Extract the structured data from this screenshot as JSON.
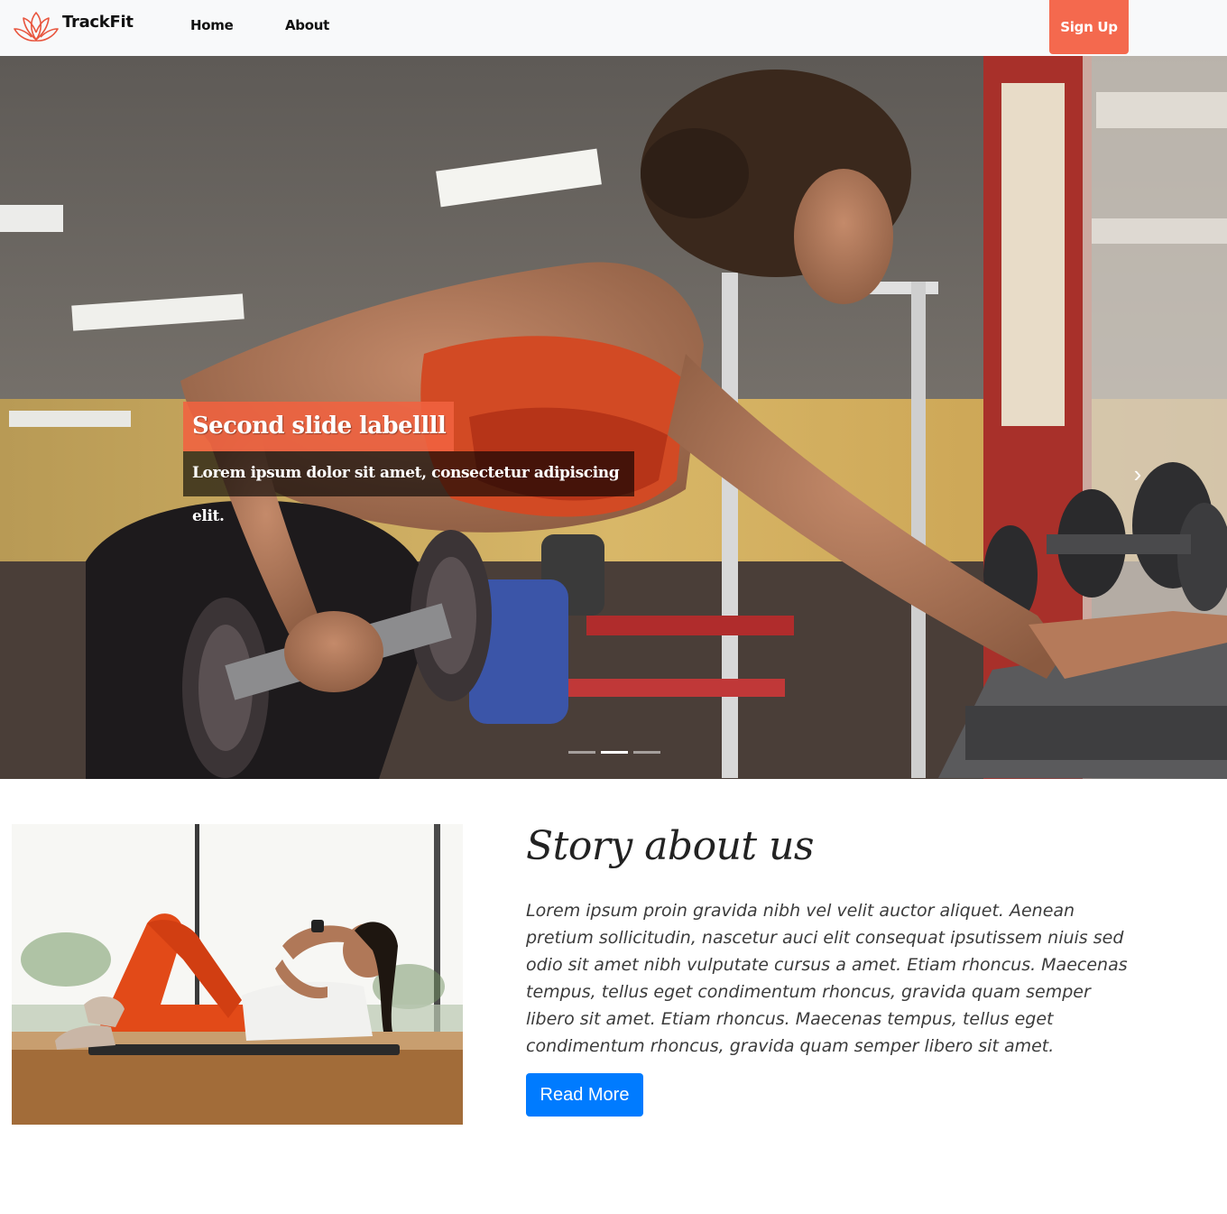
{
  "navbar": {
    "brand": "TrackFit",
    "links": [
      "Home",
      "About"
    ],
    "signup_label": "Sign Up",
    "logo_icon": "lotus-icon",
    "accent_color": "#f4694e"
  },
  "carousel": {
    "caption_title": "Second slide labellll",
    "caption_text": "Lorem ipsum dolor sit amet, consectetur adipiscing elit.",
    "slide_count": 3,
    "active_slide": 2,
    "next_icon": "chevron-right-icon",
    "prev_icon": "chevron-left-icon"
  },
  "story": {
    "title": "Story about us",
    "body": "Lorem ipsum proin gravida nibh vel velit auctor aliquet. Aenean pretium sollicitudin, nascetur auci elit consequat ipsutissem niuis sed odio sit amet nibh vulputate cursus a amet. Etiam rhoncus. Maecenas tempus, tellus eget condimentum rhoncus, gravida quam semper libero sit amet. Etiam rhoncus. Maecenas tempus, tellus eget condimentum rhoncus, gravida quam semper libero sit amet.",
    "button_label": "Read More",
    "button_color": "#007bff"
  }
}
